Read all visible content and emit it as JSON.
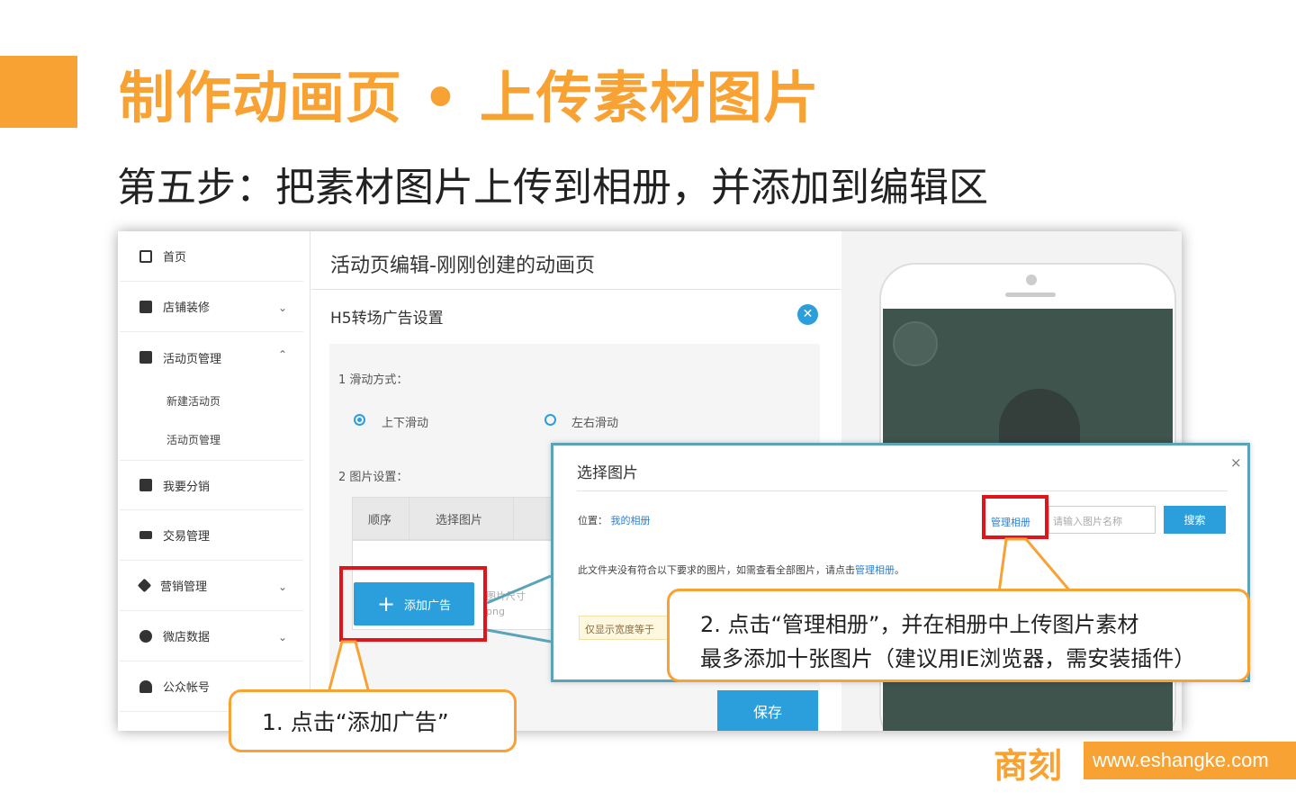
{
  "slide": {
    "title": "制作动画页 • 上传素材图片",
    "subtitle": "第五步：把素材图片上传到相册，并添加到编辑区",
    "brand_logo": "商刻",
    "brand_url": "www.eshangke.com"
  },
  "sidebar": {
    "items": [
      {
        "label": "首页",
        "icon": "grid-icon"
      },
      {
        "label": "店铺装修",
        "icon": "store-icon"
      },
      {
        "label": "活动页管理",
        "icon": "bag-icon"
      },
      {
        "label": "我要分销",
        "icon": "lock-bag-icon"
      },
      {
        "label": "交易管理",
        "icon": "card-icon"
      },
      {
        "label": "营销管理",
        "icon": "tag-icon"
      },
      {
        "label": "微店数据",
        "icon": "pie-icon"
      },
      {
        "label": "公众帐号",
        "icon": "user-icon"
      }
    ],
    "subitems": [
      "新建活动页",
      "活动页管理"
    ]
  },
  "editor": {
    "page_title": "活动页编辑-刚刚创建的动画页",
    "panel_title": "H5转场广告设置",
    "step1_label": "1 滑动方式：",
    "radio_vertical": "上下滑动",
    "radio_horizontal": "左右滑动",
    "step2_label": "2 图片设置：",
    "col_order": "顺序",
    "col_select": "选择图片",
    "add_button": "添加广告",
    "size_hint": "图片尺寸",
    "format_hint": "png",
    "save_button": "保存"
  },
  "dialog": {
    "title": "选择图片",
    "close": "×",
    "location_label": "位置：",
    "location_value": "我的相册",
    "manage_album": "管理相册",
    "search_placeholder": "请输入图片名称",
    "search_button": "搜索",
    "empty_msg": "此文件夹没有符合以下要求的图片，如需查看全部图片，请点击",
    "empty_link": "管理相册",
    "empty_end": "。",
    "notice": "仅显示宽度等于"
  },
  "callouts": {
    "step1": "1. 点击“添加广告”",
    "step2_line1": "2. 点击“管理相册”，并在相册中上传图片素材",
    "step2_line2": "最多添加十张图片（建议用IE浏览器，需安装插件）"
  },
  "colors": {
    "accent": "#f7a233",
    "primary_blue": "#2a9fdb",
    "highlight_red": "#e0141b"
  }
}
